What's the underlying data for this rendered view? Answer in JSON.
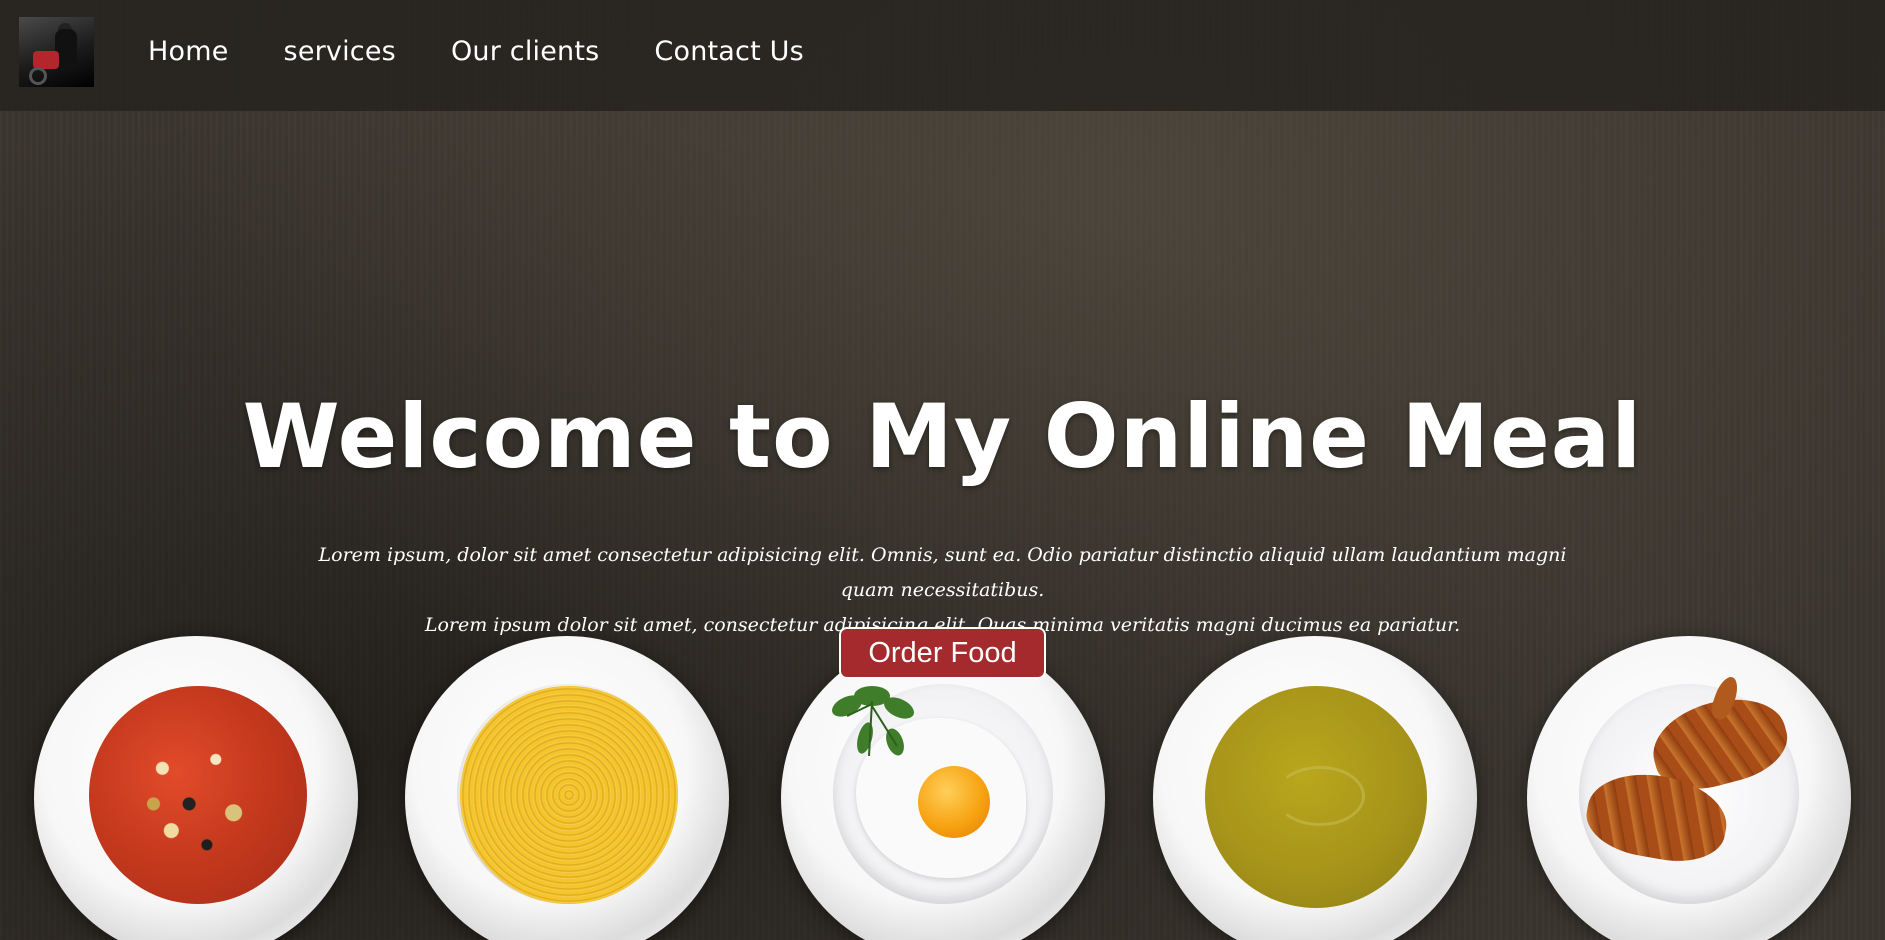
{
  "nav": {
    "logo_icon": "motorbike-rider-icon",
    "links": [
      "Home",
      "services",
      "Our clients",
      "Contact Us"
    ]
  },
  "hero": {
    "title": "Welcome to My Online Meal",
    "text_line1": "Lorem ipsum, dolor sit amet consectetur adipisicing elit. Omnis, sunt ea. Odio pariatur distinctio aliquid ullam laudantium magni quam necessitatibus.",
    "text_line2": "Lorem ipsum dolor sit amet, consectetur adipisicing elit. Quas minima veritatis magni ducimus ea pariatur.",
    "order_button": "Order Food"
  },
  "plates": [
    "minestrone-soup",
    "spaghetti",
    "fried-egg",
    "pea-soup",
    "croissants"
  ],
  "colors": {
    "accent": "#a42a2d",
    "background": "#3a352e",
    "navbar": "#26231e"
  }
}
